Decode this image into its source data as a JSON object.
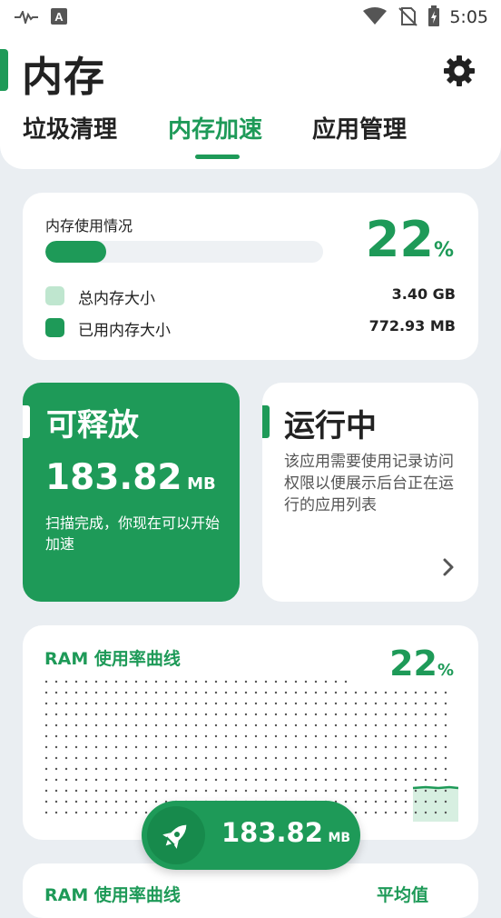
{
  "status_bar": {
    "time": "5:05"
  },
  "header": {
    "title": "内存",
    "tabs": [
      {
        "label": "垃圾清理",
        "active": false
      },
      {
        "label": "内存加速",
        "active": true
      },
      {
        "label": "应用管理",
        "active": false
      }
    ]
  },
  "memory_usage": {
    "label": "内存使用情况",
    "percent": "22",
    "percent_symbol": "%",
    "fill_fraction": 0.22,
    "legend": [
      {
        "label": "总内存大小",
        "value": "3.40 GB",
        "color": "#bfe6cf"
      },
      {
        "label": "已用内存大小",
        "value": "772.93 MB",
        "color": "#1e9a58"
      }
    ]
  },
  "release_card": {
    "title": "可释放",
    "size": "183.82",
    "unit": "MB",
    "description": "扫描完成，你现在可以开始加速"
  },
  "running_card": {
    "title": "运行中",
    "description": "该应用需要使用记录访问权限以便展示后台正在运行的应用列表"
  },
  "ram_chart": {
    "title": "RAM 使用率曲线",
    "percent": "22",
    "percent_symbol": "%"
  },
  "ram_chart_2": {
    "title": "RAM 使用率曲线",
    "avg_label": "平均值"
  },
  "boost_button": {
    "size": "183.82",
    "unit": "MB"
  },
  "colors": {
    "accent": "#1e9a58",
    "background": "#eaeef2",
    "light_green": "#bfe6cf"
  }
}
